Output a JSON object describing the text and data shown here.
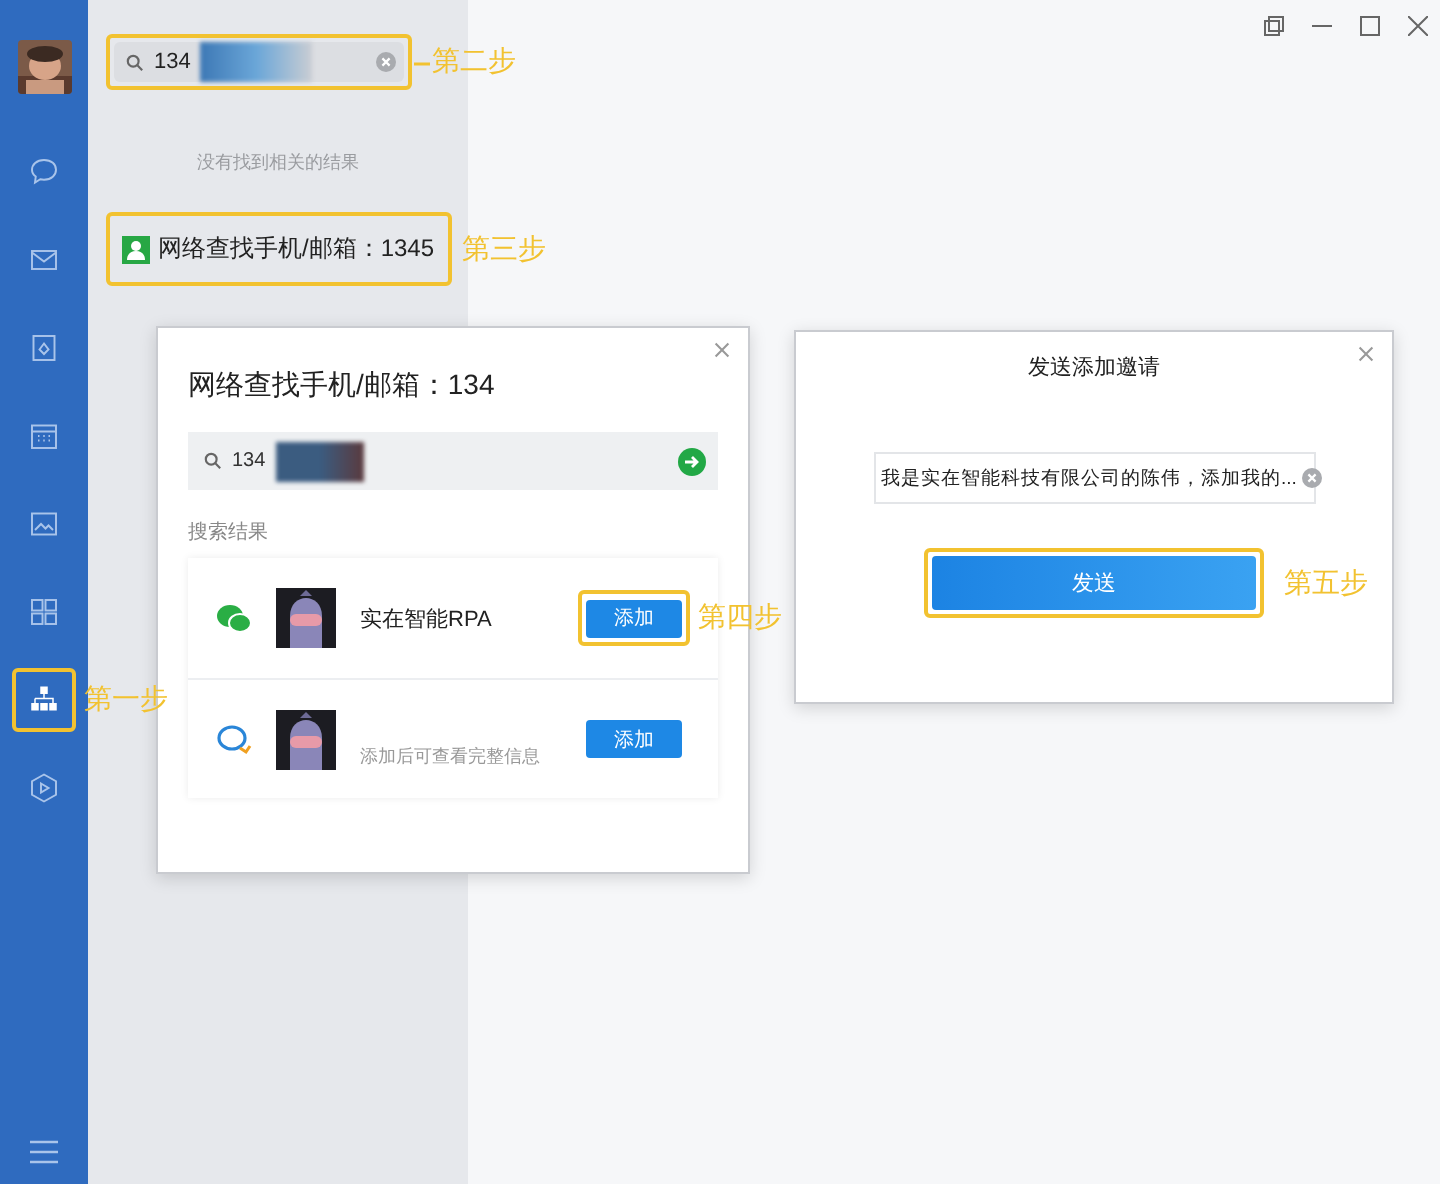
{
  "sidebar": {
    "items": [
      {
        "selected": false
      },
      {
        "selected": false
      },
      {
        "selected": false
      },
      {
        "selected": false
      },
      {
        "selected": false
      },
      {
        "selected": false
      },
      {
        "selected": true,
        "step": "第一步"
      },
      {
        "selected": false
      }
    ]
  },
  "search": {
    "value": "134",
    "step": "第二步"
  },
  "no_results": "没有找到相关的结果",
  "network_search": {
    "label": "网络查找手机/邮箱：1345",
    "step": "第三步"
  },
  "search_dialog": {
    "title": "网络查找手机/邮箱：134",
    "search_value": "134",
    "section": "搜索结果",
    "results": [
      {
        "kind": "wechat",
        "name": "实在智能RPA",
        "button": "添加",
        "step": "第四步"
      },
      {
        "kind": "wecom",
        "hint": "添加后可查看完整信息",
        "button": "添加"
      }
    ]
  },
  "invite_dialog": {
    "title": "发送添加邀请",
    "message": "我是实在智能科技有限公司的陈伟，添加我的...",
    "button": "发送",
    "step": "第五步"
  }
}
